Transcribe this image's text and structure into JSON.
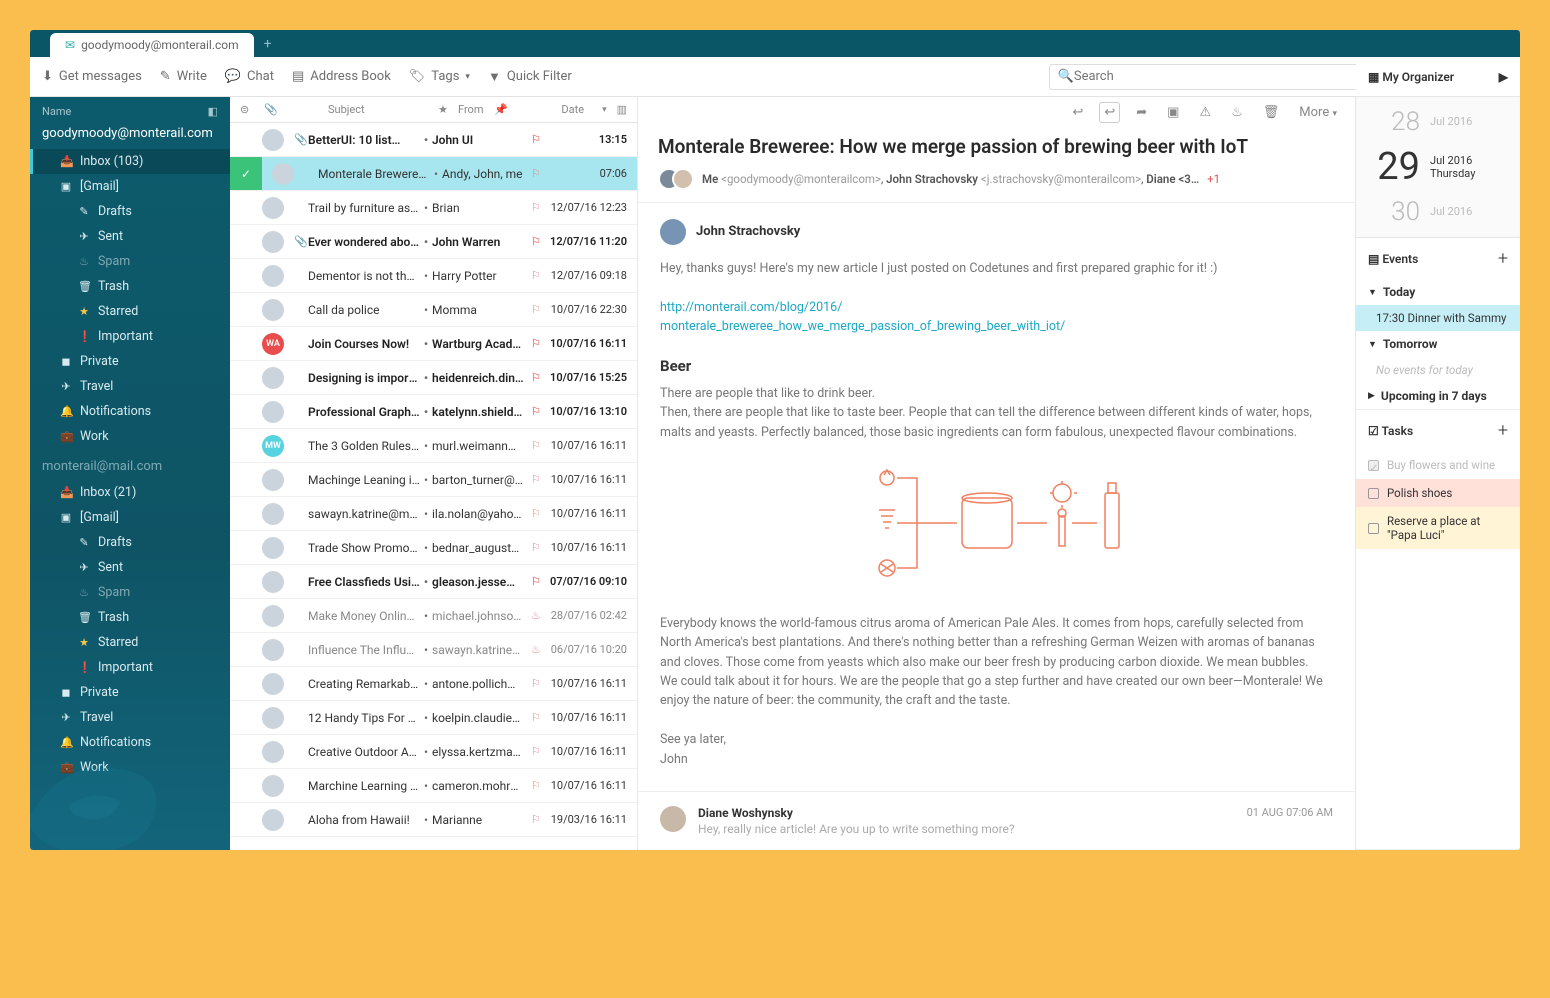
{
  "tab": {
    "label": "goodymoody@monterail.com"
  },
  "toolbar": {
    "get": "Get messages",
    "write": "Write",
    "chat": "Chat",
    "address": "Address Book",
    "tags": "Tags",
    "filter": "Quick Filter",
    "searchPlaceholder": "Search"
  },
  "sidebar": {
    "header": "Name",
    "accounts": [
      {
        "email": "goodymoody@monterail.com",
        "folders": [
          {
            "icon": "📥",
            "label": "Inbox (103)",
            "active": true
          },
          {
            "icon": "▣",
            "label": "[Gmail]"
          },
          {
            "icon": "✎",
            "label": "Drafts",
            "sub": true
          },
          {
            "icon": "✈",
            "label": "Sent",
            "sub": true
          },
          {
            "icon": "♨",
            "label": "Spam",
            "sub": true,
            "muted": true
          },
          {
            "icon": "🗑",
            "label": "Trash",
            "sub": true
          },
          {
            "icon": "★",
            "label": "Starred",
            "sub": true,
            "star": true
          },
          {
            "icon": "❗",
            "label": "Important",
            "sub": true,
            "imp": true
          },
          {
            "icon": "◼",
            "label": "Private"
          },
          {
            "icon": "✈",
            "label": "Travel"
          },
          {
            "icon": "🔔",
            "label": "Notifications"
          },
          {
            "icon": "💼",
            "label": "Work"
          }
        ]
      },
      {
        "email": "monterail@mail.com",
        "muted": true,
        "folders": [
          {
            "icon": "📥",
            "label": "Inbox  (21)"
          },
          {
            "icon": "▣",
            "label": "[Gmail]"
          },
          {
            "icon": "✎",
            "label": "Drafts",
            "sub": true
          },
          {
            "icon": "✈",
            "label": "Sent",
            "sub": true
          },
          {
            "icon": "♨",
            "label": "Spam",
            "sub": true,
            "muted": true
          },
          {
            "icon": "🗑",
            "label": "Trash",
            "sub": true
          },
          {
            "icon": "★",
            "label": "Starred",
            "sub": true,
            "star": true
          },
          {
            "icon": "❗",
            "label": "Important",
            "sub": true,
            "imp": true
          },
          {
            "icon": "◼",
            "label": "Private"
          },
          {
            "icon": "✈",
            "label": "Travel"
          },
          {
            "icon": "🔔",
            "label": "Notifications"
          },
          {
            "icon": "💼",
            "label": "Work"
          }
        ]
      }
    ]
  },
  "listHeader": {
    "subject": "Subject",
    "from": "From",
    "date": "Date"
  },
  "messages": [
    {
      "av": "",
      "att": true,
      "subject": "BetterUI: 10 list…",
      "from": "John UI",
      "date": "13:15",
      "unread": true
    },
    {
      "av": "",
      "subject": "Monterale Breweree: H…",
      "from": "Andy, John, me",
      "date": "07:06",
      "selected": true
    },
    {
      "av": "",
      "subject": "Trail by furniture as…",
      "from": "Brian",
      "date": "12/07/16 12:23"
    },
    {
      "av": "",
      "att": true,
      "subject": "Ever wondered abou…",
      "from": "John Warren",
      "date": "12/07/16 11:20",
      "unread": true
    },
    {
      "av": "",
      "subject": "Dementor is not that bad",
      "from": "Harry Potter",
      "date": "12/07/16 09:18"
    },
    {
      "av": "",
      "subject": "Call da police",
      "from": "Momma",
      "date": "10/07/16 22:30"
    },
    {
      "av": "WA",
      "avc": "#e84c4c",
      "subject": "Join Courses Now!",
      "from": "Wartburg Academy",
      "date": "10/07/16 16:11",
      "unread": true
    },
    {
      "av": "",
      "subject": "Designing is important",
      "from": "heidenreich.din@yaho…",
      "date": "10/07/16 15:25",
      "unread": true
    },
    {
      "av": "",
      "subject": "Professional Graphic De…",
      "from": "katelynn.shields@yahoo…",
      "date": "10/07/16 13:10",
      "unread": true
    },
    {
      "av": "MW",
      "avc": "#57d3e0",
      "subject": "The 3 Golden Rules Proff…",
      "from": "murl.weimann@kovacek…",
      "date": "10/07/16 16:11"
    },
    {
      "av": "",
      "subject": "Machinge Leaning is …",
      "from": "barton_turner@effertz.co…",
      "date": "10/07/16 16:11"
    },
    {
      "av": "",
      "subject": "sawayn.katrine@manley…",
      "from": "ila.nolan@yahoo.com",
      "date": "10/07/16 16:11"
    },
    {
      "av": "",
      "subject": "Trade Show Promotions",
      "from": "bednar_august@henderso…",
      "date": "10/07/16 16:11"
    },
    {
      "av": "",
      "subject": "Free Classfieds Using Th…",
      "from": "gleason.jesse@yahoo.com",
      "date": "07/07/16 09:10",
      "unread": true
    },
    {
      "av": "",
      "subject": "Make Money Online Thr…",
      "from": "michael.johnsonn@abc.c…",
      "date": "28/07/16 02:42",
      "read": true,
      "flame": true
    },
    {
      "av": "",
      "subject": "Influence The Influence…",
      "from": "sawayn.katrine@manley…",
      "date": "06/07/16 10:20",
      "read": true,
      "flame": true
    },
    {
      "av": "",
      "subject": "Creating Remarkable Po…",
      "from": "antone.pollich@yadira.io",
      "date": "10/07/16 16:11"
    },
    {
      "av": "",
      "subject": "12 Handy Tips For Gener…",
      "from": "koelpin.claudie@gmail…",
      "date": "10/07/16 16:11"
    },
    {
      "av": "",
      "subject": "Creative Outdoor Ads",
      "from": "elyssa.kertzmann@yahoo…",
      "date": "10/07/16 16:11"
    },
    {
      "av": "",
      "subject": "Marchine Learning is …",
      "from": "cameron.mohr@ariane.na…",
      "date": "10/07/16 16:11"
    },
    {
      "av": "",
      "subject": "Aloha from Hawaii!",
      "from": "Marianne",
      "date": "19/03/16 16:11"
    }
  ],
  "reader": {
    "actions": {
      "more": "More"
    },
    "title": "Monterale Breweree: How we merge passion of brewing beer with IoT",
    "meta": {
      "me": "Me",
      "meAddr": "<goodymoody@monterailcom>",
      "p1": "John Strachovsky",
      "p1Addr": "<j.strachovsky@monterailcom>",
      "p2": "Diane <3…",
      "plus": "+1"
    },
    "author": "John Strachovsky",
    "intro": "Hey, thanks guys! Here's my new article I just posted on Codetunes and first prepared graphic for it! :)",
    "link": "http://monterail.com/blog/2016/\nmonterale_breweree_how_we_merge_passion_of_brewing_beer_with_iot/",
    "h": "Beer",
    "p1": "There are people that like to drink beer.",
    "p2": "Then, there are people that like to taste beer. People that can tell the difference between different kinds of water, hops, malts and yeasts. Perfectly balanced, those basic ingredients can form fabulous, unexpected flavour combinations.",
    "p3": "Everybody knows the world-famous citrus aroma of American Pale Ales. It comes from hops, carefully selected from North America's best plantations. And there's nothing better than a refreshing German Weizen with aromas of bananas and cloves. Those come from yeasts which also make our beer fresh by producing carbon dioxide. We mean bubbles.",
    "p4": "We could talk about it for hours. We are the people that go a step further and have created our own beer—Monterale! We enjoy the nature of beer: the community, the craft and the taste.",
    "sig1": "See ya later,",
    "sig2": "John",
    "reply": {
      "author": "Diane Woshynsky",
      "date": "01 AUG 07:06 AM",
      "text": "Hey, really nice article! Are you up to write something more?"
    }
  },
  "organizer": {
    "title": "My Organizer",
    "days": [
      {
        "n": "28",
        "mon": "Jul 2016"
      },
      {
        "n": "29",
        "mon": "Jul 2016",
        "dow": "Thursday",
        "big": true
      },
      {
        "n": "30",
        "mon": "Jul 2016"
      }
    ],
    "eventsTitle": "Events",
    "groups": [
      {
        "label": "Today",
        "open": true,
        "items": [
          {
            "text": "17:30 Dinner with Sammy",
            "hl": true
          }
        ]
      },
      {
        "label": "Tomorrow",
        "open": true,
        "items": [
          {
            "text": "No events for today",
            "muted": true
          }
        ]
      },
      {
        "label": "Upcoming in 7 days",
        "open": false
      }
    ],
    "tasksTitle": "Tasks",
    "tasks": [
      {
        "text": "Buy flowers and wine",
        "done": true
      },
      {
        "text": "Polish shoes",
        "cls": "r"
      },
      {
        "text": "Reserve a place at  \"Papa Luci\"",
        "cls": "y"
      }
    ]
  }
}
